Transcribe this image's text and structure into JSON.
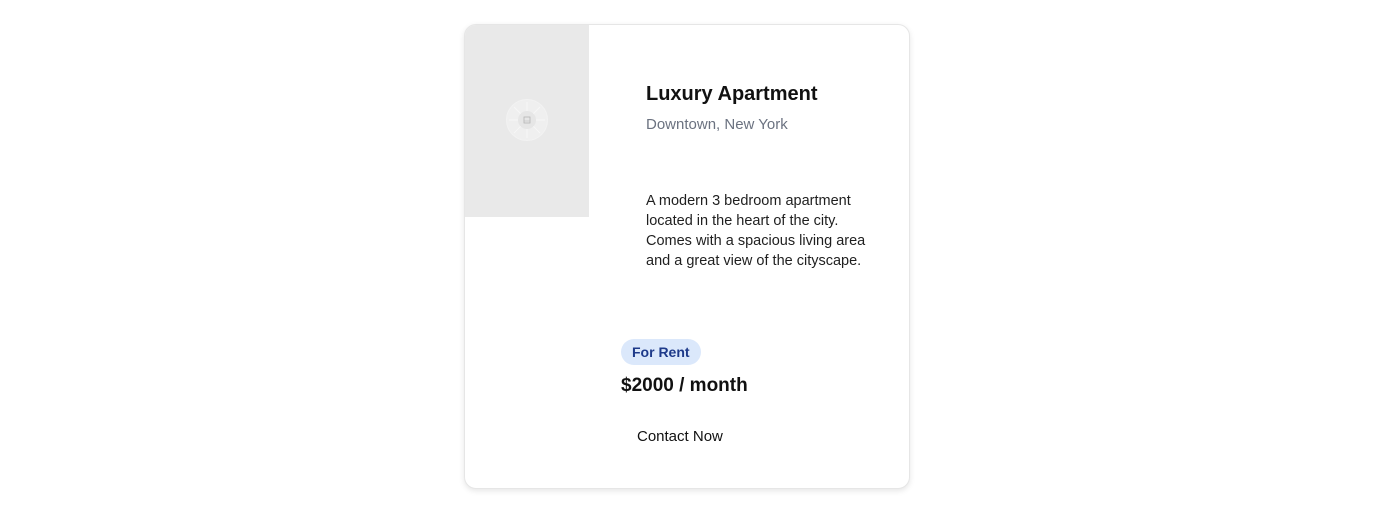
{
  "listing": {
    "title": "Luxury Apartment",
    "location": "Downtown, New York",
    "description": "A modern 3 bedroom apartment located in the heart of the city. Comes with a spacious living area and a great view of the cityscape.",
    "badge": "For Rent",
    "price": "$2000 / month",
    "contact_label": "Contact Now",
    "image_icon": "image-placeholder-icon"
  },
  "colors": {
    "badge_background": "#dbe8fb",
    "badge_text": "#1e3a8a",
    "location_text": "#6b7280",
    "image_placeholder": "#e9e9e9"
  }
}
